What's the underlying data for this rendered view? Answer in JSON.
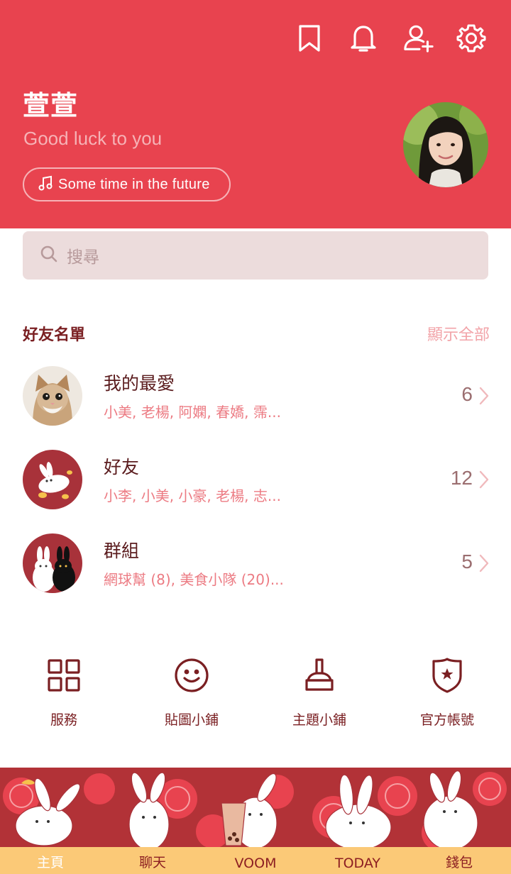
{
  "header": {
    "icons": [
      "bookmark-icon",
      "bell-icon",
      "add-friend-icon",
      "gear-icon"
    ],
    "profile": {
      "name": "萱萱",
      "status": "Good luck to you",
      "music": "Some time in the future"
    }
  },
  "search": {
    "placeholder": "搜尋"
  },
  "friends": {
    "title": "好友名單",
    "show_all": "顯示全部",
    "groups": [
      {
        "title": "我的最愛",
        "members": "小美, 老楊, 阿嫻, 春嬌, 霈...",
        "count": "6"
      },
      {
        "title": "好友",
        "members": "小李, 小美, 小豪, 老楊, 志...",
        "count": "12"
      },
      {
        "title": "群組",
        "members": "網球幫 (8), 美食小隊 (20)...",
        "count": "5"
      }
    ]
  },
  "shortcuts": [
    {
      "label": "服務",
      "icon": "grid-icon"
    },
    {
      "label": "貼圖小鋪",
      "icon": "smiley-icon"
    },
    {
      "label": "主題小鋪",
      "icon": "brush-icon"
    },
    {
      "label": "官方帳號",
      "icon": "shield-star-icon"
    }
  ],
  "tabs": [
    {
      "label": "主頁",
      "active": true
    },
    {
      "label": "聊天"
    },
    {
      "label": "VOOM"
    },
    {
      "label": "TODAY"
    },
    {
      "label": "錢包"
    }
  ],
  "colors": {
    "accent": "#e8434f",
    "dark_text": "#7a1f22",
    "pink_text": "#ec7b83",
    "tabbar": "#b23237",
    "tab_strip": "#fbc977"
  }
}
